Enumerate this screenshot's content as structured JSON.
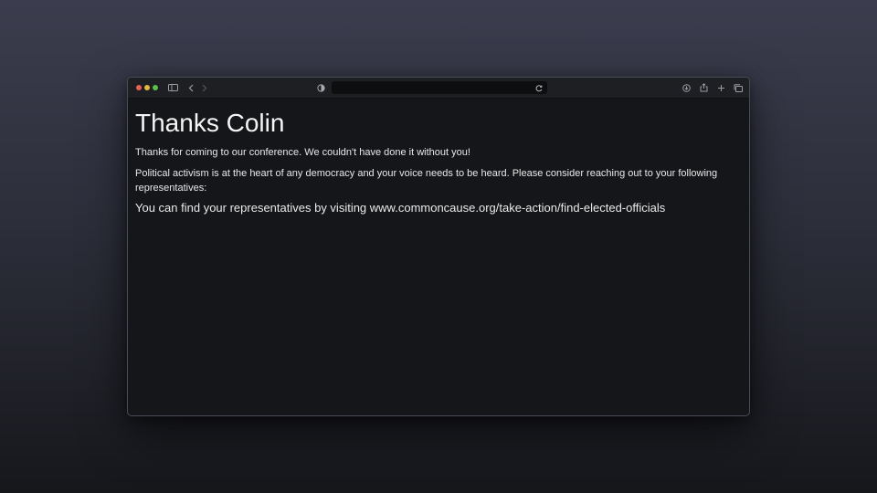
{
  "browser": {
    "address_bar": {
      "url": ""
    },
    "icons": {
      "sidebar": "sidebar-icon",
      "back": "chevron-left-icon",
      "forward": "chevron-right-icon",
      "privacy": "shield-icon",
      "reload": "reload-icon",
      "download": "download-icon",
      "share": "share-icon",
      "new_tab": "plus-icon",
      "tabs": "tabs-overview-icon"
    },
    "traffic_lights": [
      "#ec5f57",
      "#e2b93f",
      "#5cbf4b"
    ]
  },
  "page": {
    "heading": "Thanks Colin",
    "thanks_text": "Thanks for coming to our conference. We couldn't have done it without you!",
    "activism_text": "Political activism is at the heart of any democracy and your voice needs to be heard. Please consider reaching out to your following representatives:",
    "find_text": "You can find your representatives by visiting www.commoncause.org/take-action/find-elected-officials"
  }
}
